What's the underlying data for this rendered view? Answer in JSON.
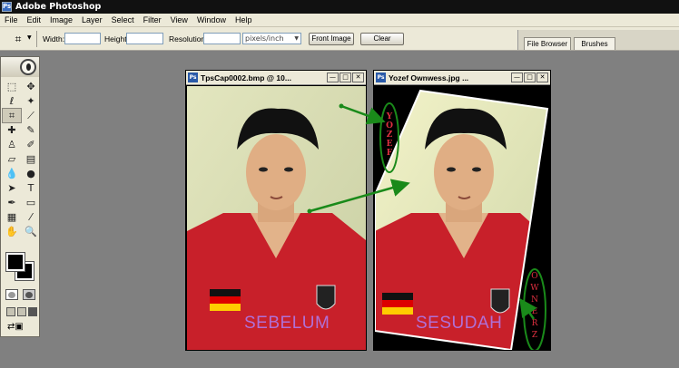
{
  "app": {
    "title": "Adobe Photoshop",
    "icon": "photoshop-icon"
  },
  "menu": [
    "File",
    "Edit",
    "Image",
    "Layer",
    "Select",
    "Filter",
    "View",
    "Window",
    "Help"
  ],
  "options": {
    "tool_icon": "crop-icon",
    "width_label": "Width:",
    "width_value": "",
    "height_label": "Height:",
    "height_value": "",
    "resolution_label": "Resolution:",
    "resolution_value": "",
    "unit_select": "pixels/inch",
    "front_image_button": "Front Image",
    "clear_button": "Clear"
  },
  "palette_well": {
    "tabs": [
      "File Browser",
      "Brushes"
    ]
  },
  "toolbox": {
    "tools": [
      "marquee-icon",
      "move-icon",
      "lasso-icon",
      "magic-wand-icon",
      "crop-icon",
      "slice-icon",
      "healing-brush-icon",
      "brush-icon",
      "clone-stamp-icon",
      "history-brush-icon",
      "eraser-icon",
      "gradient-icon",
      "blur-icon",
      "dodge-icon",
      "path-select-icon",
      "type-icon",
      "pen-icon",
      "shape-icon",
      "notes-icon",
      "eyedropper-icon",
      "hand-icon",
      "zoom-icon"
    ],
    "foreground_color": "#000000",
    "background_color": "#000000"
  },
  "documents": [
    {
      "title": "TpsCap0002.bmp @ 10...",
      "caption": "SEBELUM"
    },
    {
      "title": "Yozef Ownwess.jpg ...",
      "caption": "SESUDAH",
      "side_text_left": "YOZEF",
      "side_text_right": "OWNERZ"
    }
  ],
  "colors": {
    "caption": "#b070d6",
    "arrow": "#1a8a1a",
    "side_text": "#e03040"
  }
}
